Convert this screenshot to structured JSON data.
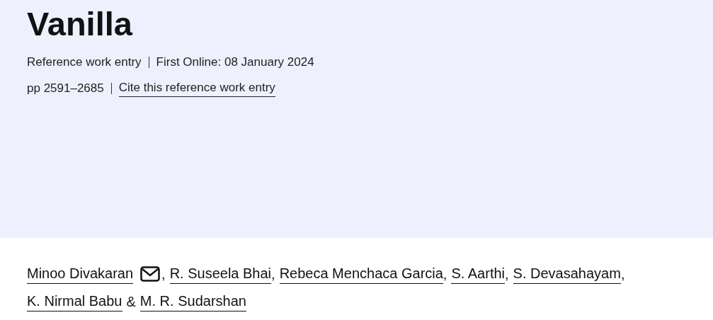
{
  "header": {
    "title": "Vanilla",
    "meta": [
      {
        "kind": "text",
        "text": "Reference work entry"
      },
      {
        "kind": "text",
        "text": "First Online: 08 January 2024"
      }
    ],
    "meta2": [
      {
        "kind": "text",
        "text": "pp 2591–2685"
      },
      {
        "kind": "link",
        "text": "Cite this reference work entry"
      }
    ]
  },
  "authors": [
    {
      "name": "Minoo Divakaran",
      "email": true,
      "separator": ","
    },
    {
      "name": "R. Suseela Bhai",
      "email": false,
      "separator": ","
    },
    {
      "name": "Rebeca Menchaca Garcia",
      "email": false,
      "separator": ","
    },
    {
      "name": "S. Aarthi",
      "email": false,
      "separator": ","
    },
    {
      "name": "S. Devasahayam",
      "email": false,
      "separator": ","
    },
    {
      "name": "K. Nirmal Babu",
      "email": false,
      "separator": "&"
    },
    {
      "name": "M. R. Sudarshan",
      "email": false
    }
  ]
}
